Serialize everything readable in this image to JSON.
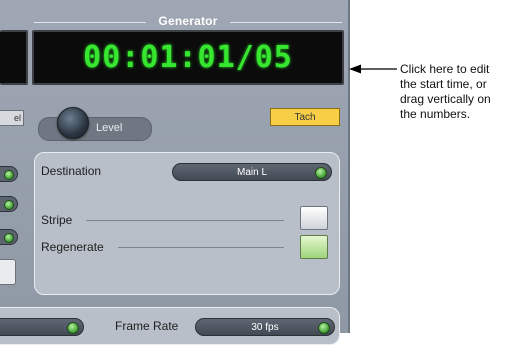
{
  "generator": {
    "title": "Generator",
    "timecode": "00:01:01/05",
    "left_button_label": "el",
    "level_label": "Level",
    "tach_label": "Tach"
  },
  "settings": {
    "destination_label": "Destination",
    "destination_value": "Main L",
    "stripe_label": "Stripe",
    "regenerate_label": "Regenerate",
    "frame_rate_label": "Frame Rate",
    "frame_rate_value": "30 fps"
  },
  "callout": {
    "text": "Click here to edit the start time, or drag vertically on the numbers."
  },
  "colors": {
    "timecode_green": "#36e62f",
    "tach_yellow": "#f7cf46",
    "panel_gray": "#9ea7b3",
    "regenerate_green": "#9fd57b"
  }
}
